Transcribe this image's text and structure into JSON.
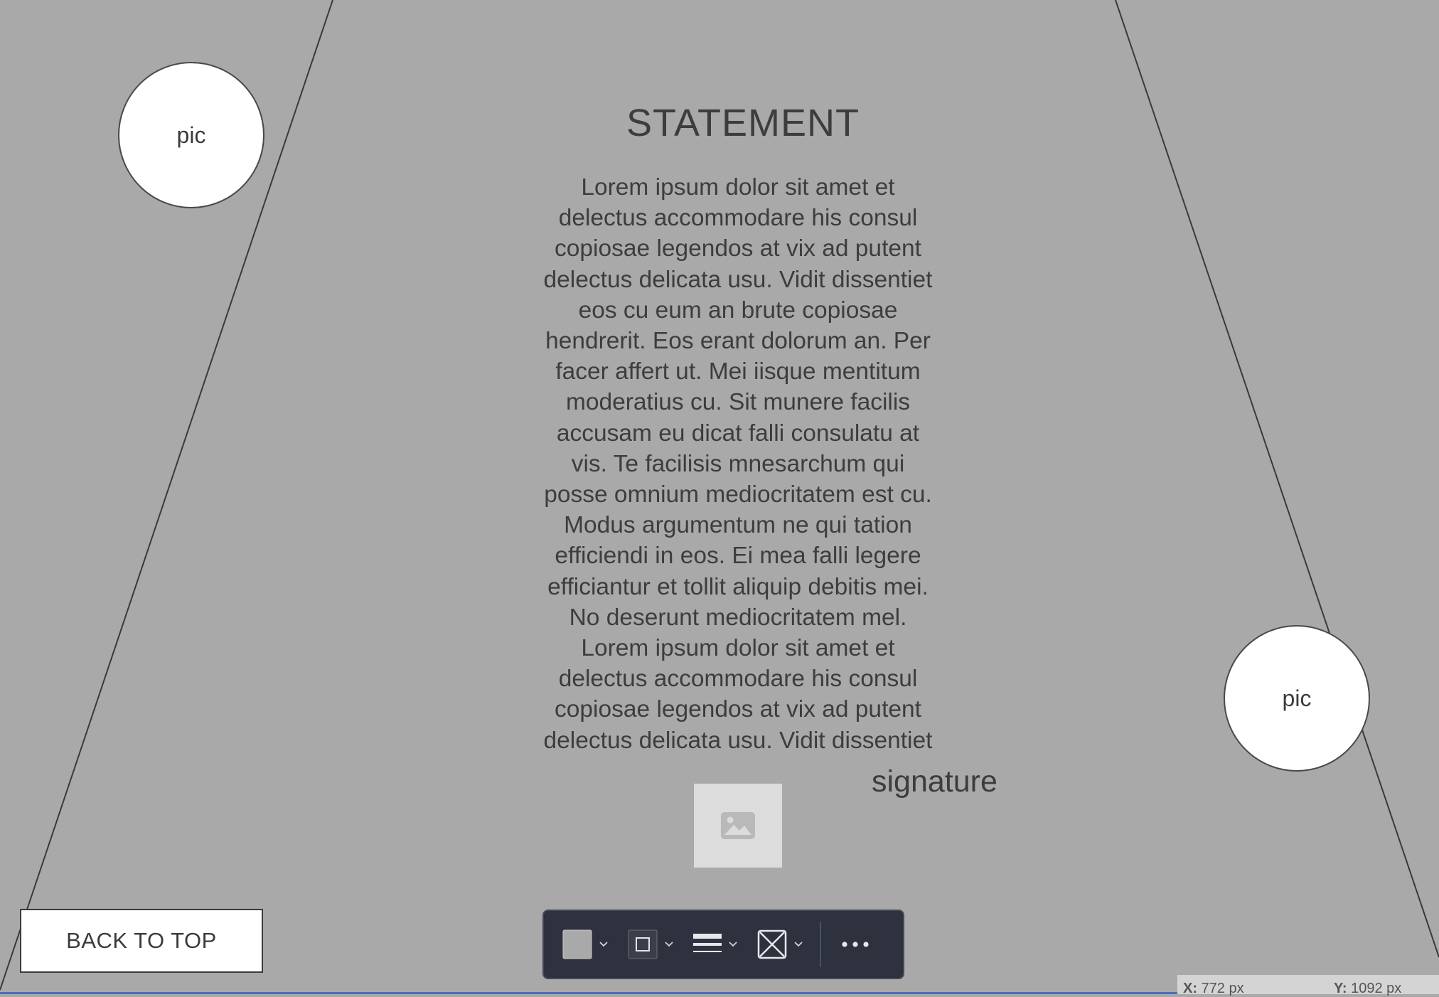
{
  "pics": {
    "left_label": "pic",
    "right_label": "pic"
  },
  "statement": {
    "title": "STATEMENT",
    "lines": [
      "Lorem ipsum dolor sit amet et",
      "delectus accommodare his consul",
      "copiosae legendos at vix ad putent",
      "delectus delicata usu. Vidit dissentiet",
      "eos cu eum an brute copiosae",
      "hendrerit. Eos erant dolorum an. Per",
      "facer affert ut. Mei iisque mentitum",
      "moderatius cu. Sit munere facilis",
      "accusam eu dicat falli consulatu at",
      "vis. Te facilisis mnesarchum qui",
      "posse omnium mediocritatem est cu.",
      "Modus argumentum ne qui tation",
      "efficiendi in eos. Ei mea falli legere",
      "efficiantur et tollit aliquip debitis mei.",
      "No deserunt mediocritatem mel.",
      "Lorem ipsum dolor sit amet et",
      "delectus accommodare his consul",
      "copiosae legendos at vix ad putent",
      "delectus delicata usu. Vidit dissentiet"
    ]
  },
  "signature": {
    "label": "signature",
    "image_icon": "image-placeholder-icon"
  },
  "back_to_top": {
    "label": "BACK TO TOP"
  },
  "toolbar": {
    "items": [
      {
        "name": "fill-color",
        "icon": "fill-swatch-icon"
      },
      {
        "name": "stroke-color",
        "icon": "stroke-swatch-icon"
      },
      {
        "name": "line-weight",
        "icon": "line-weight-icon"
      },
      {
        "name": "shape-style",
        "icon": "crossed-box-icon"
      },
      {
        "name": "more",
        "icon": "more-dots-icon"
      }
    ]
  },
  "status": {
    "x_label": "X:",
    "x_value": "772 px",
    "y_label": "Y:",
    "y_value": "1092 px"
  },
  "colors": {
    "background": "#a9a9a9",
    "toolbar": "#2e323e",
    "text": "#3d3d3d"
  }
}
